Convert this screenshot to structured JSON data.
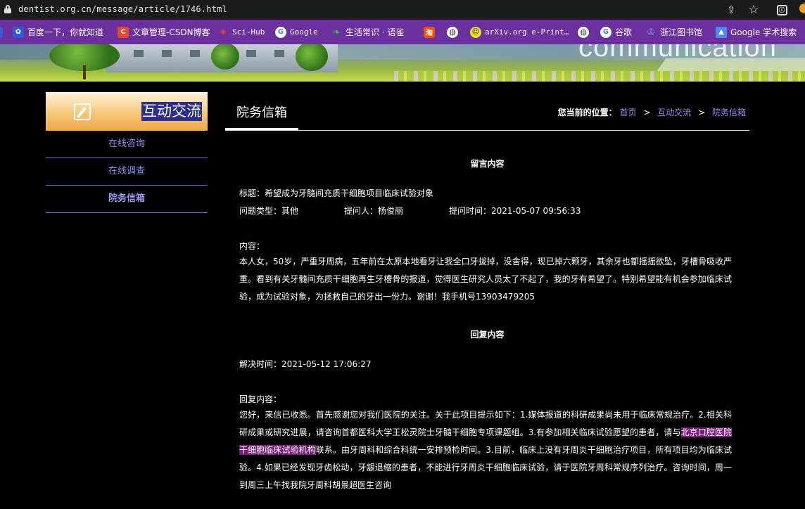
{
  "browser": {
    "url": "dentist.org.cn/message/article/1746.html",
    "bookmarks": [
      {
        "label": "百度一下，你就知道",
        "icon": "baidu-paw-icon",
        "color": "#2d5bd6"
      },
      {
        "label": "文章管理-CSDN博客",
        "icon": "csdn-icon",
        "color": "#e5462c"
      },
      {
        "label": "Sci-Hub",
        "icon": "scihub-eye-icon",
        "color": "#c02828"
      },
      {
        "label": "Google",
        "icon": "google-icon",
        "color": "#ffffff"
      },
      {
        "label": "生活常识 · 语雀",
        "icon": "yuque-leaf-icon",
        "color": "#2fbf4a"
      },
      {
        "label": "淘",
        "icon": "taobao-icon",
        "color": "#ff5000"
      },
      {
        "label": "globe",
        "icon": "globe-icon",
        "color": "#ffffff"
      },
      {
        "label": "arXiv.org e-Print…",
        "icon": "arxiv-smiley-icon",
        "color": "#e8e020"
      },
      {
        "label": "globe",
        "icon": "globe-icon",
        "color": "#ffffff"
      },
      {
        "label": "谷歌",
        "icon": "google-icon",
        "color": "#ffffff"
      },
      {
        "label": "浙江图书馆",
        "icon": "library-icon",
        "color": "#3a5bd0"
      },
      {
        "label": "Google 学术搜索",
        "icon": "google-scholar-icon",
        "color": "#4a8af4"
      }
    ]
  },
  "banner": {
    "text": "communication"
  },
  "sidebar": {
    "title": "互动交流",
    "items": [
      {
        "label": "在线咨询",
        "active": false
      },
      {
        "label": "在线调查",
        "active": false
      },
      {
        "label": "院务信箱",
        "active": true
      }
    ]
  },
  "main": {
    "title": "院务信箱",
    "breadcrumb": {
      "label": "您当前的位置：",
      "items": [
        "首页",
        "互动交流",
        "院务信箱"
      ],
      "separator": ">"
    },
    "message": {
      "heading": "留言内容",
      "title_line": "标题：希望成为牙髓间充质干细胞项目临床试验对象",
      "type": "问题类型：其他",
      "asker": "提问人：杨俊丽",
      "time": "提问时间：2021-05-07 09:56:33",
      "content_label": "内容：",
      "content": "本人女，50岁，严重牙周病，五年前在太原本地看牙让我全口牙拔掉，没舍得，现已掉六颗牙，其余牙也都摇摇欲坠，牙槽骨吸收严重。看到有关牙髓间充质干细胞再生牙槽骨的报道，觉得医生研究人员太了不起了，我的牙有希望了。特别希望能有机会参加临床试验，成为试验对象，为拯救自己的牙出一份力。谢谢！我手机号13903479205"
    },
    "reply": {
      "heading": "回复内容",
      "resolved_time": "解决时间：2021-05-12 17:06:27",
      "content_label": "回复内容：",
      "content_before": "您好，来信已收悉。首先感谢您对我们医院的关注。关于此项目提示如下：1.媒体报道的科研成果尚未用于临床常规治疗。2.相关科研成果或研究进展，请咨询首都医科大学王松灵院士牙髓干细胞专项课题组。3.有参加相关临床试验愿望的患者，请与",
      "highlight": "北京口腔医院干细胞临床试验机构",
      "content_after": "联系。由牙周科和综合科统一安排预检时间。3.目前，临床上没有牙周炎干细胞治疗项目，所有项目均为临床试验。4.如果已经发现牙齿松动，牙龈退缩的患者，不能进行牙周炎干细胞临床试验，请于医院牙周科常规序列治疗。咨询时间，周一到周三上午找我院牙周科胡景超医生咨询"
    }
  }
}
